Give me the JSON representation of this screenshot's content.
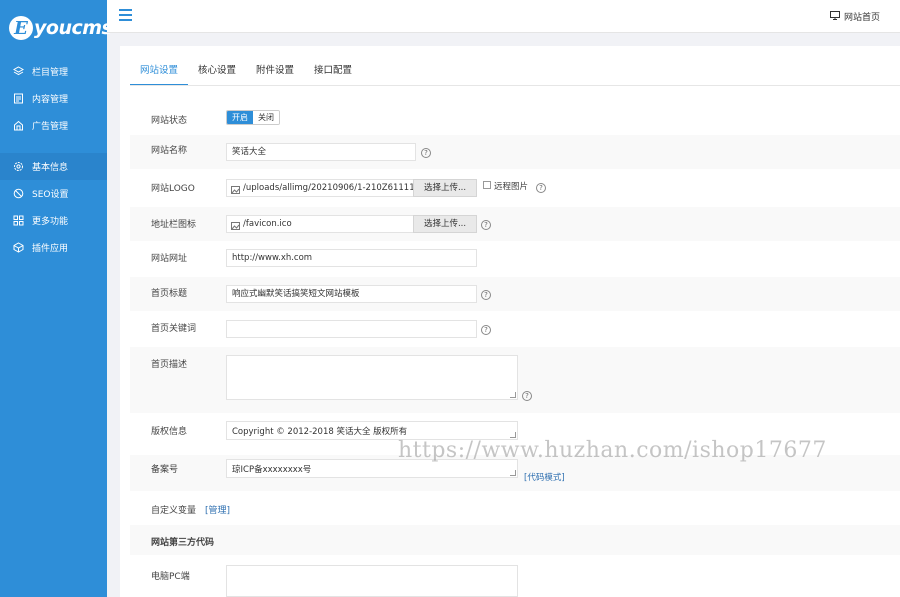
{
  "brand": {
    "logo_letter": "E",
    "logo_text": "youcms"
  },
  "sidebar": {
    "items": [
      {
        "label": "栏目管理",
        "icon": "layers-icon"
      },
      {
        "label": "内容管理",
        "icon": "document-icon"
      },
      {
        "label": "广告管理",
        "icon": "ad-icon"
      },
      {
        "label": "基本信息",
        "icon": "gear-icon",
        "active": true
      },
      {
        "label": "SEO设置",
        "icon": "seo-icon"
      },
      {
        "label": "更多功能",
        "icon": "grid-icon"
      },
      {
        "label": "插件应用",
        "icon": "plugin-icon"
      }
    ]
  },
  "header": {
    "site_home": "网站首页"
  },
  "tabs": [
    {
      "label": "网站设置",
      "active": true
    },
    {
      "label": "核心设置"
    },
    {
      "label": "附件设置"
    },
    {
      "label": "接口配置"
    }
  ],
  "form": {
    "status": {
      "label": "网站状态",
      "on": "开启",
      "off": "关闭"
    },
    "site_name": {
      "label": "网站名称",
      "value": "笑话大全"
    },
    "logo": {
      "label": "网站LOGO",
      "value": "/uploads/allimg/20210906/1-210Z611114",
      "button": "选择上传...",
      "remote_label": "远程图片"
    },
    "favicon": {
      "label": "地址栏图标",
      "value": "/favicon.ico",
      "button": "选择上传..."
    },
    "site_url": {
      "label": "网站网址",
      "value": "http://www.xh.com"
    },
    "home_title": {
      "label": "首页标题",
      "value": "响应式幽默笑话搞笑短文网站模板"
    },
    "home_keywords": {
      "label": "首页关键词",
      "value": ""
    },
    "home_desc": {
      "label": "首页描述",
      "value": ""
    },
    "copyright": {
      "label": "版权信息",
      "value": "Copyright © 2012-2018 笑话大全 版权所有"
    },
    "icp": {
      "label": "备案号",
      "value": "琼ICP备xxxxxxxx号",
      "code_mode": "[代码模式]"
    },
    "custom_vars": {
      "label": "自定义变量",
      "manage": "[管理]"
    },
    "third_party": {
      "label": "网站第三方代码"
    },
    "pc": {
      "label": "电脑PC端",
      "value": ""
    }
  },
  "watermark": "https://www.huzhan.com/ishop17677",
  "colors": {
    "accent": "#2e8ed8",
    "sidebar": "#2e8ed8"
  }
}
